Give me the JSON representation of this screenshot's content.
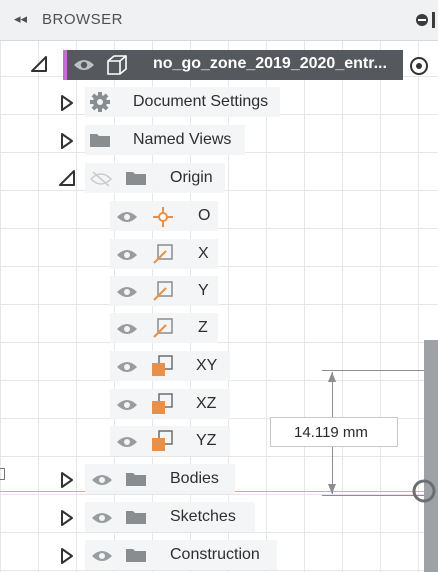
{
  "browser": {
    "collapse_glyph": "◂◂",
    "title": "BROWSER"
  },
  "root": {
    "name": "no_go_zone_2019_2020_entr...",
    "accent_color": "#c86bd6"
  },
  "items": {
    "document_settings": "Document Settings",
    "named_views": "Named Views",
    "origin": "Origin",
    "origin_point": "O",
    "x_axis": "X",
    "y_axis": "Y",
    "z_axis": "Z",
    "xy_plane": "XY",
    "xz_plane": "XZ",
    "yz_plane": "YZ",
    "bodies": "Bodies",
    "sketches": "Sketches",
    "construction": "Construction"
  },
  "dimension": {
    "value": "14.119 mm"
  },
  "colors": {
    "plane_orange": "#e8904a",
    "header_bg": "#f0f1f2",
    "root_bg": "#55585c"
  }
}
